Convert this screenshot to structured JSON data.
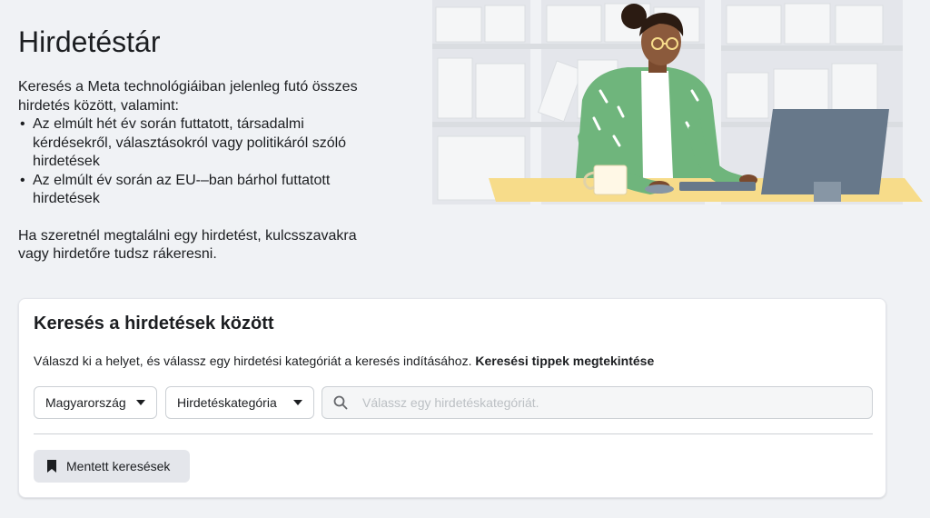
{
  "intro": {
    "title": "Hirdetéstár",
    "paragraph1": "Keresés a Meta technológiáiban jelenleg futó összes hirdetés között, valamint:",
    "bullets": [
      "Az elmúlt hét év során futtatott, társadalmi kérdésekről, választásokról vagy politikáról szóló hirdetések",
      "Az elmúlt év során az EU-–ban bárhol futtatott hirdetések"
    ],
    "paragraph2": "Ha szeretnél megtalálni egy hirdetést, kulcsszavakra vagy hirdetőre tudsz rákeresni."
  },
  "search_card": {
    "title": "Keresés a hirdetések között",
    "description": "Válaszd ki a helyet, és válassz egy hirdetési kategóriát a keresés indításához.",
    "tips_link": "Keresési tippek megtekintése",
    "country_dropdown": "Magyarország",
    "category_dropdown": "Hirdetéskategória",
    "search_placeholder": "Válassz egy hirdetéskategóriát.",
    "saved_searches_button": "Mentett keresések"
  },
  "colors": {
    "page_bg": "#f0f2f5",
    "card_bg": "#ffffff",
    "button_bg": "#e4e6eb",
    "shirt_green": "#6fb57c",
    "desk_yellow": "#f7dc8a",
    "monitor_gray": "#67788a"
  },
  "icons": {
    "dropdown": "caret-down-icon",
    "search": "search-icon",
    "saved": "bookmark-icon"
  }
}
